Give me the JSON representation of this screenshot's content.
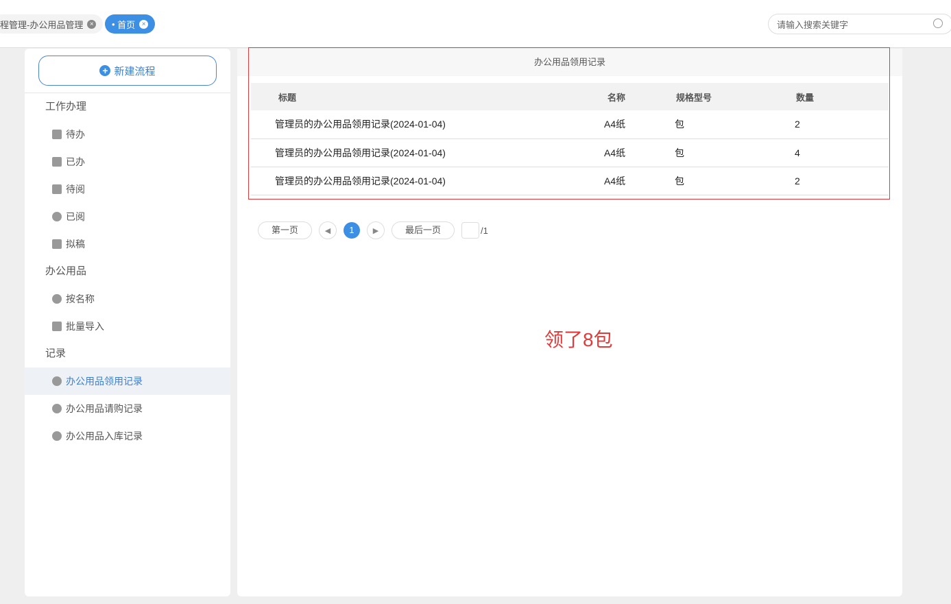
{
  "tabs": [
    {
      "label": "程管理-办公用品管理"
    },
    {
      "label": "首页"
    }
  ],
  "search": {
    "placeholder": "请输入搜索关键字"
  },
  "sidebar": {
    "new_button": "新建流程",
    "groups": [
      {
        "label": "工作办理",
        "items": [
          {
            "label": "待办"
          },
          {
            "label": "已办"
          },
          {
            "label": "待阅"
          },
          {
            "label": "已阅"
          },
          {
            "label": "拟稿"
          }
        ]
      },
      {
        "label": "办公用品",
        "items": [
          {
            "label": "按名称"
          },
          {
            "label": "批量导入"
          }
        ]
      },
      {
        "label": "记录",
        "items": [
          {
            "label": "办公用品领用记录",
            "active": true
          },
          {
            "label": "办公用品请购记录"
          },
          {
            "label": "办公用品入库记录"
          }
        ]
      }
    ]
  },
  "table": {
    "caption": "办公用品领用记录",
    "headers": [
      "标题",
      "名称",
      "规格型号",
      "数量"
    ],
    "rows": [
      [
        "管理员的办公用品领用记录(2024-01-04)",
        "A4纸",
        "包",
        "2"
      ],
      [
        "管理员的办公用品领用记录(2024-01-04)",
        "A4纸",
        "包",
        "4"
      ],
      [
        "管理员的办公用品领用记录(2024-01-04)",
        "A4纸",
        "包",
        "2"
      ]
    ]
  },
  "pager": {
    "first": "第一页",
    "current": "1",
    "last": "最后一页",
    "total": "/1"
  },
  "annotation": "领了8包"
}
